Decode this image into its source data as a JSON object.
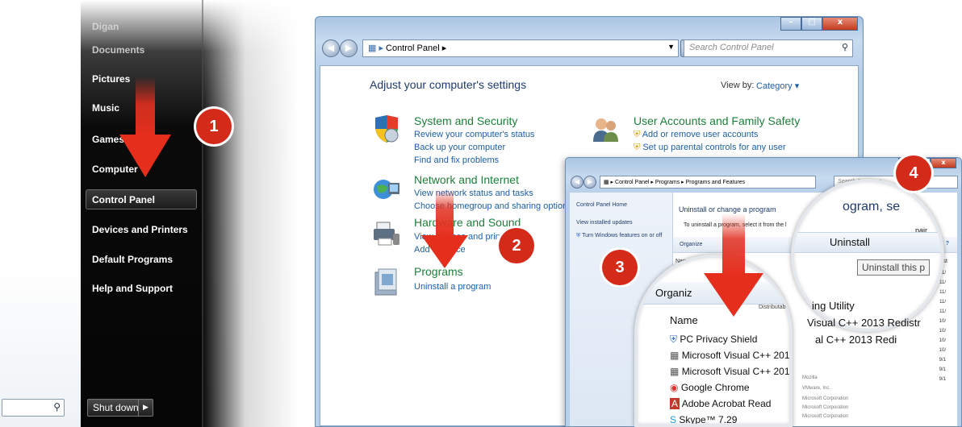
{
  "start_menu": {
    "user": "Digan",
    "items": [
      "Documents",
      "Pictures",
      "Music",
      "Games",
      "Computer",
      "Control Panel",
      "Devices and Printers",
      "Default Programs",
      "Help and Support"
    ],
    "shutdown": "Shut down"
  },
  "steps": [
    "1",
    "2",
    "3",
    "4"
  ],
  "control_panel": {
    "breadcrumb": "Control Panel",
    "search_placeholder": "Search Control Panel",
    "heading": "Adjust your computer's settings",
    "view_by_label": "View by:",
    "view_by_value": "Category",
    "categories": [
      {
        "title": "System and Security",
        "links": [
          "Review your computer's status",
          "Back up your computer",
          "Find and fix problems"
        ]
      },
      {
        "title": "Network and Internet",
        "links": [
          "View network status and tasks",
          "Choose homegroup and sharing option"
        ]
      },
      {
        "title": "Hardware and Sound",
        "links": [
          "View devices and print",
          "Add a device"
        ]
      },
      {
        "title": "Programs",
        "links": [
          "Uninstall a program"
        ]
      },
      {
        "title": "User Accounts and Family Safety",
        "links": [
          "Add or remove user accounts",
          "Set up parental controls for any user"
        ]
      }
    ]
  },
  "programs_features": {
    "breadcrumb": [
      "Control Panel",
      "Programs",
      "Programs and Features"
    ],
    "search_placeholder": "Search Programs",
    "sidebar": [
      "Control Panel Home",
      "View installed updates",
      "Turn Windows features on or off"
    ],
    "title": "Uninstall or change a program",
    "description": "To uninstall a program, select it from the l",
    "toolbar_organize": "Organize",
    "col_name": "Name",
    "col_installed": "Inst",
    "publishers": [
      "Mozilla",
      "VMware, Inc.",
      "Microsoft Corporation",
      "Microsoft Corporation",
      "Microsoft Corporation"
    ],
    "dates": [
      "11/",
      "11/",
      "11/",
      "11/",
      "11/",
      "10/",
      "10/",
      "10/",
      "10/",
      "9/1",
      "9/1",
      "9/1"
    ]
  },
  "lens_left": {
    "organize": "Organiz",
    "name_header": "Name",
    "programs": [
      "PC Privacy Shield",
      "Microsoft Visual C++ 201",
      "Microsoft Visual C++ 201",
      "Google Chrome",
      "Adobe Acrobat Read",
      "Skype™ 7.29"
    ],
    "right_snippets": [
      "Distributab",
      "ing Utility",
      "Visual C++ 2013 Redistr",
      "al C++ 2013 Redi"
    ]
  },
  "lens_right": {
    "title_fragment": "ogram, se",
    "repair": "pair.",
    "uninstall_button": "Uninstall",
    "tooltip": "Uninstall this p"
  }
}
